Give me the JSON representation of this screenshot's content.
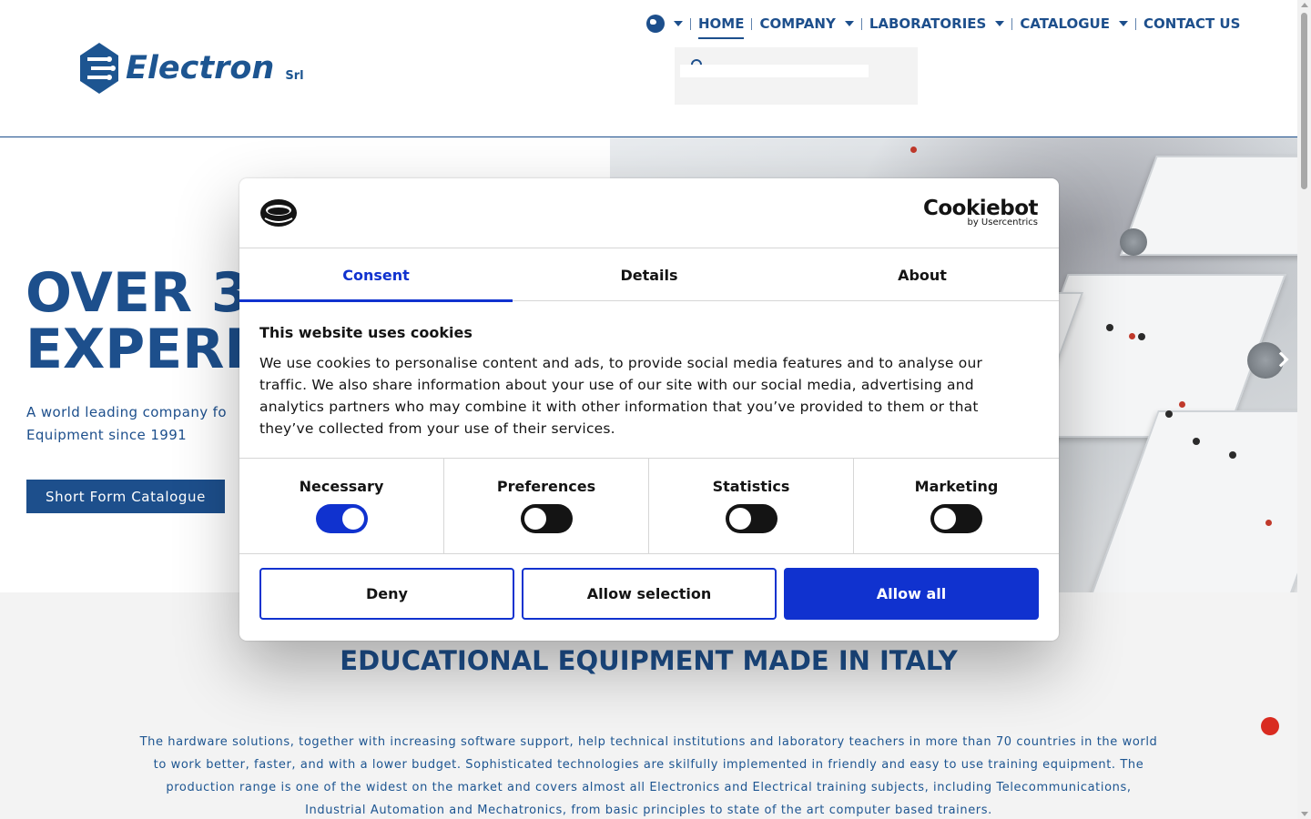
{
  "site": {
    "logo_text": "Electron",
    "logo_suffix": "Srl"
  },
  "nav": {
    "items": [
      {
        "label": "HOME"
      },
      {
        "label": "COMPANY"
      },
      {
        "label": "LABORATORIES"
      },
      {
        "label": "CATALOGUE"
      },
      {
        "label": "CONTACT US"
      }
    ]
  },
  "hero": {
    "title_line1": "OVER 3",
    "title_line2": "EXPERI",
    "subtitle_line1": "A world leading company fo",
    "subtitle_line2": "Equipment since 1991",
    "cta_label": "Short Form Catalogue"
  },
  "section2": {
    "heading": "EDUCATIONAL EQUIPMENT MADE IN ITALY",
    "body": "The hardware solutions, together with increasing software support, help technical institutions and laboratory teachers in more than 70 countries in the world to work better, faster, and with a lower budget. Sophisticated technologies are skilfully implemented in friendly and easy to use training equipment. The production range is one of the widest on the market and covers almost all Electronics and Electrical training subjects, including Telecommunications, Industrial Automation and Mechatronics, from basic principles to state of the art computer based trainers."
  },
  "cookie": {
    "brand_name": "Cookiebot",
    "brand_by": "by Usercentrics",
    "tabs": [
      {
        "label": "Consent"
      },
      {
        "label": "Details"
      },
      {
        "label": "About"
      }
    ],
    "heading": "This website uses cookies",
    "body": "We use cookies to personalise content and ads, to provide social media features and to analyse our traffic. We also share information about your use of our site with our social media, advertising and analytics partners who may combine it with other information that you’ve provided to them or that they’ve collected from your use of their services.",
    "toggles": [
      {
        "label": "Necessary",
        "on": true
      },
      {
        "label": "Preferences",
        "on": false
      },
      {
        "label": "Statistics",
        "on": false
      },
      {
        "label": "Marketing",
        "on": false
      }
    ],
    "buttons": {
      "deny": "Deny",
      "allow_selection": "Allow selection",
      "allow_all": "Allow all"
    },
    "accent_color": "#1032cf"
  },
  "colors": {
    "brand": "#1d4f8c",
    "chat": "#d92b20"
  }
}
